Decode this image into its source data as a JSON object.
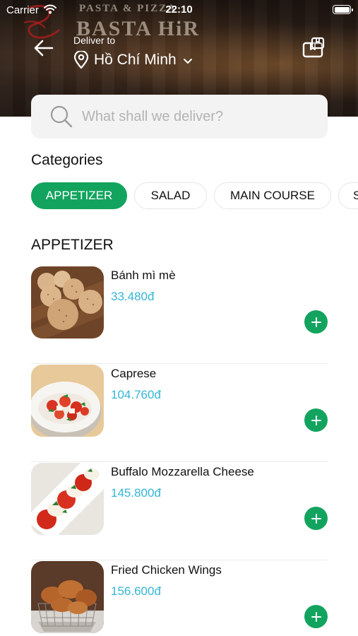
{
  "status_bar": {
    "carrier": "Carrier",
    "time": "22:10"
  },
  "header": {
    "deliver_label": "Deliver to",
    "city": "Hồ Chí Minh",
    "background_sign_small": "PASTA & PIZZA",
    "background_sign_large": "BASTA HiR",
    "icons": {
      "back": "arrow-left-icon",
      "location": "location-pin-icon",
      "dropdown": "chevron-down-icon",
      "box": "package-box-icon"
    }
  },
  "search": {
    "placeholder": "What shall we deliver?",
    "value": "",
    "icon": "search-icon"
  },
  "categories": {
    "title": "Categories",
    "items": [
      {
        "label": "APPETIZER",
        "active": true
      },
      {
        "label": "SALAD",
        "active": false
      },
      {
        "label": "MAIN COURSE",
        "active": false
      },
      {
        "label": "S",
        "active": false
      }
    ]
  },
  "section": {
    "title": "APPETIZER",
    "items": [
      {
        "name": "Bánh mì mè",
        "price": "33.480đ"
      },
      {
        "name": "Caprese",
        "price": "104.760đ"
      },
      {
        "name": "Buffalo Mozzarella Cheese",
        "price": "145.800đ"
      },
      {
        "name": "Fried Chicken Wings",
        "price": "156.600đ"
      }
    ]
  },
  "colors": {
    "accent_green": "#12a45e",
    "price_blue": "#35b6d6",
    "search_bg": "#f3f3f3"
  }
}
